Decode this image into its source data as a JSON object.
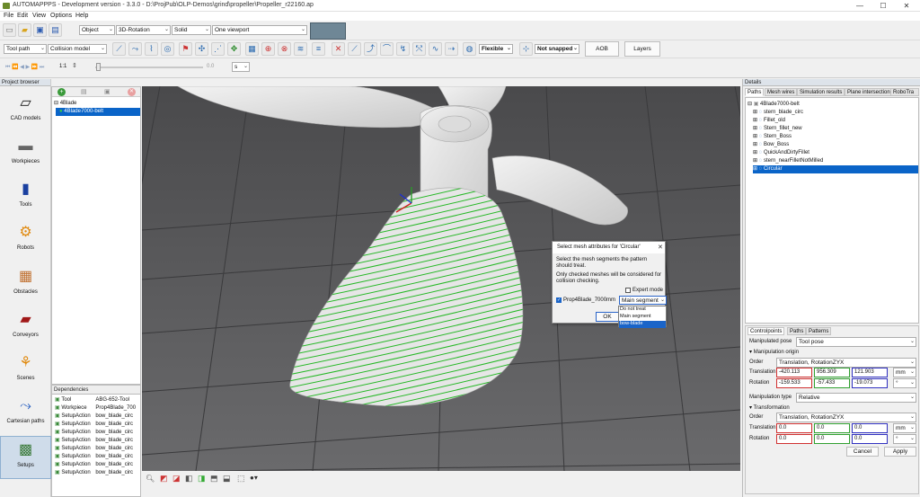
{
  "window": {
    "title": "AUTOMAPPPS - Development version - 3.3.0 - D:\\ProjPub\\OLP-Demos\\grind\\propeller\\Propeller_r22160.ap"
  },
  "menu": [
    "File",
    "Edit",
    "View",
    "Options",
    "Help"
  ],
  "toolbar1": {
    "object_mode": "Object",
    "rotation_mode": "3D-Rotation",
    "render_mode": "Solid",
    "viewport_mode": "One viewport"
  },
  "toolbar2": {
    "tool_path": "Tool path",
    "collision_model": "Collision model",
    "flexible": "Flexible",
    "snap": "Not snapped",
    "aob": "AOB",
    "layers": "Layers"
  },
  "toolbar3": {
    "speed": "1:1",
    "time": "0.0",
    "unit": "s"
  },
  "left_panel": {
    "header": "Project browser",
    "categories": [
      {
        "label": "CAD models",
        "icon": "cad-models-icon"
      },
      {
        "label": "Workpieces",
        "icon": "workpieces-icon"
      },
      {
        "label": "Tools",
        "icon": "tools-icon"
      },
      {
        "label": "Robots",
        "icon": "robots-icon"
      },
      {
        "label": "Obstacles",
        "icon": "obstacles-icon"
      },
      {
        "label": "Conveyors",
        "icon": "conveyors-icon"
      },
      {
        "label": "Scenes",
        "icon": "scenes-icon"
      },
      {
        "label": "Cartesian paths",
        "icon": "cartesian-paths-icon"
      },
      {
        "label": "Setups",
        "icon": "setups-icon"
      }
    ]
  },
  "project_tree": {
    "root": "4Blade",
    "child": "4Blade7000-belt"
  },
  "dependencies": {
    "header": "Dependencies",
    "rows": [
      {
        "type": "Tool",
        "name": "ABG-652-Tool"
      },
      {
        "type": "Workpiece",
        "name": "Prop4Blade_700"
      },
      {
        "type": "SetupAction",
        "name": "bow_blade_circ"
      },
      {
        "type": "SetupAction",
        "name": "bow_blade_circ"
      },
      {
        "type": "SetupAction",
        "name": "bow_blade_circ"
      },
      {
        "type": "SetupAction",
        "name": "bow_blade_circ"
      },
      {
        "type": "SetupAction",
        "name": "bow_blade_circ"
      },
      {
        "type": "SetupAction",
        "name": "bow_blade_circ"
      },
      {
        "type": "SetupAction",
        "name": "bow_blade_circ"
      },
      {
        "type": "SetupAction",
        "name": "bow_blade_circ"
      }
    ]
  },
  "details": {
    "header": "Details",
    "tabs": [
      "Paths",
      "Mesh wires",
      "Simulation results",
      "Plane intersection",
      "RoboTra"
    ],
    "tree_root": "4Blade7000-belt",
    "tree_items": [
      "stern_blade_circ",
      "Fillet_old",
      "Stern_fillet_new",
      "Stern_Boss",
      "Bow_Boss",
      "QuickAndDirtyFillet",
      "stern_nearFilletNotMilled",
      "Circular"
    ]
  },
  "controlpoints": {
    "tabs": [
      "Controlpoints",
      "Paths",
      "Patterns"
    ],
    "manipulated_pose_label": "Manipulated pose",
    "manipulated_pose": "Tool pose",
    "manip_origin_label": "Manipulation origin",
    "order_label": "Order",
    "order": "Translation, RotationZYX",
    "translation_label": "Translation",
    "translation": [
      "-420.113",
      "956.309",
      "121.903"
    ],
    "translation_unit": "mm",
    "rotation_label": "Rotation",
    "rotation": [
      "-159.533",
      "-57.433",
      "-19.073"
    ],
    "rotation_unit": "°",
    "manip_type_label": "Manipulation type",
    "manip_type": "Relative",
    "transformation_label": "Transformation",
    "order2": "Translation, RotationZYX",
    "translation2": [
      "0.0",
      "0.0",
      "0.0"
    ],
    "rotation2": [
      "0.0",
      "0.0",
      "0.0"
    ],
    "cancel": "Cancel",
    "apply": "Apply",
    "colors": {
      "x": "#d03030",
      "y": "#30a030",
      "z": "#3030c0"
    }
  },
  "dialog": {
    "title": "Select mesh attributes for 'Circular'",
    "line1": "Select the mesh segments the pattern should treat.",
    "line2": "Only checked meshes will be considered for collision checking.",
    "expert_mode": "Expert mode",
    "mesh_name": "Prop4Blade_7000mm",
    "segment_selected": "Main segment",
    "segment_options": [
      "Do not treat",
      "Main segment",
      "bow-blade"
    ],
    "ok": "OK"
  }
}
